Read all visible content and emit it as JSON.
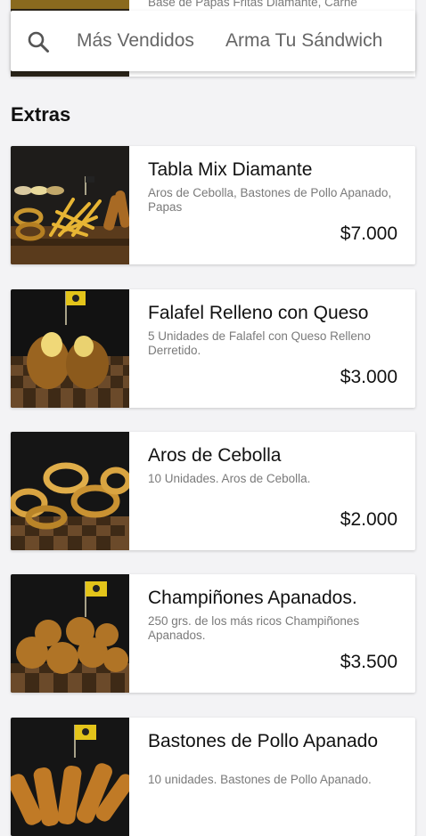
{
  "top_card": {
    "description": "Base de Papas Fritas Diamante, Carne"
  },
  "nav": {
    "search_icon": "search-icon",
    "categories": [
      "Más Vendidos",
      "Arma Tu Sándwich"
    ]
  },
  "section": {
    "title": "Extras"
  },
  "products": [
    {
      "name": "Tabla Mix Diamante",
      "description": "Aros de Cebolla, Bastones de Pollo Apanado, Papas",
      "price": "$7.000"
    },
    {
      "name": "Falafel Relleno con Queso",
      "description": "5 Unidades de Falafel con Queso Relleno Derretido.",
      "price": "$3.000"
    },
    {
      "name": "Aros de Cebolla",
      "description": "10 Unidades. Aros de Cebolla.",
      "price": "$2.000"
    },
    {
      "name": "Champiñones Apanados.",
      "description": "250 grs. de los más ricos Champiñones Apanados.",
      "price": "$3.500"
    },
    {
      "name": "Bastones de Pollo Apanado",
      "description": "10 unidades. Bastones de Pollo Apanado."
    }
  ]
}
